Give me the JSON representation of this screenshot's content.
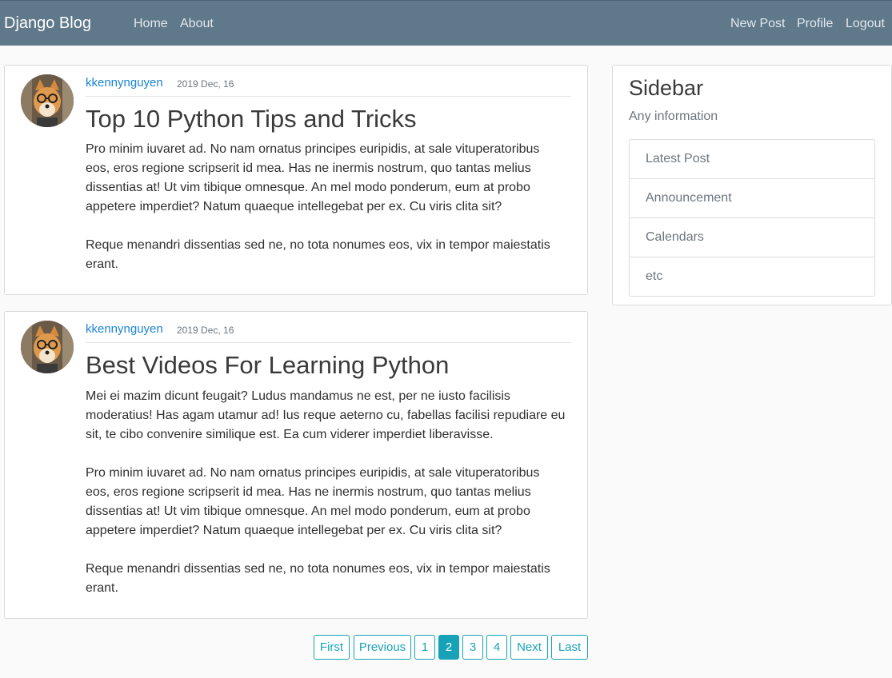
{
  "navbar": {
    "brand": "Django Blog",
    "left_links": [
      "Home",
      "About"
    ],
    "right_links": [
      "New Post",
      "Profile",
      "Logout"
    ]
  },
  "posts": [
    {
      "author": "kkennynguyen",
      "date": "2019 Dec, 16",
      "title": "Top 10 Python Tips and Tricks",
      "paragraphs": [
        "Pro minim iuvaret ad. No nam ornatus principes euripidis, at sale vituperatoribus eos, eros regione scripserit id mea. Has ne inermis nostrum, quo tantas melius dissentias at! Ut vim tibique omnesque. An mel modo ponderum, eum at probo appetere imperdiet? Natum quaeque intellegebat per ex. Cu viris clita sit?",
        "Reque menandri dissentias sed ne, no tota nonumes eos, vix in tempor maiestatis erant."
      ]
    },
    {
      "author": "kkennynguyen",
      "date": "2019 Dec, 16",
      "title": "Best Videos For Learning Python",
      "paragraphs": [
        "Mei ei mazim dicunt feugait? Ludus mandamus ne est, per ne iusto facilisis moderatius! Has agam utamur ad! Ius reque aeterno cu, fabellas facilisi repudiare eu sit, te cibo convenire similique est. Ea cum viderer imperdiet liberavisse.",
        "Pro minim iuvaret ad. No nam ornatus principes euripidis, at sale vituperatoribus eos, eros regione scripserit id mea. Has ne inermis nostrum, quo tantas melius dissentias at! Ut vim tibique omnesque. An mel modo ponderum, eum at probo appetere imperdiet? Natum quaeque intellegebat per ex. Cu viris clita sit?",
        "Reque menandri dissentias sed ne, no tota nonumes eos, vix in tempor maiestatis erant."
      ]
    }
  ],
  "sidebar": {
    "title": "Sidebar",
    "subtitle": "Any information",
    "items": [
      "Latest Post",
      "Announcement",
      "Calendars",
      "etc"
    ]
  },
  "pagination": {
    "first": "First",
    "previous": "Previous",
    "pages": [
      "1",
      "2",
      "3",
      "4"
    ],
    "current": "2",
    "next": "Next",
    "last": "Last"
  },
  "colors": {
    "navbar": "#5f788a",
    "link": "#1a84d6",
    "accent": "#17a2b8"
  },
  "icons": {
    "avatar": "shiba-dog-with-glasses-avatar"
  }
}
